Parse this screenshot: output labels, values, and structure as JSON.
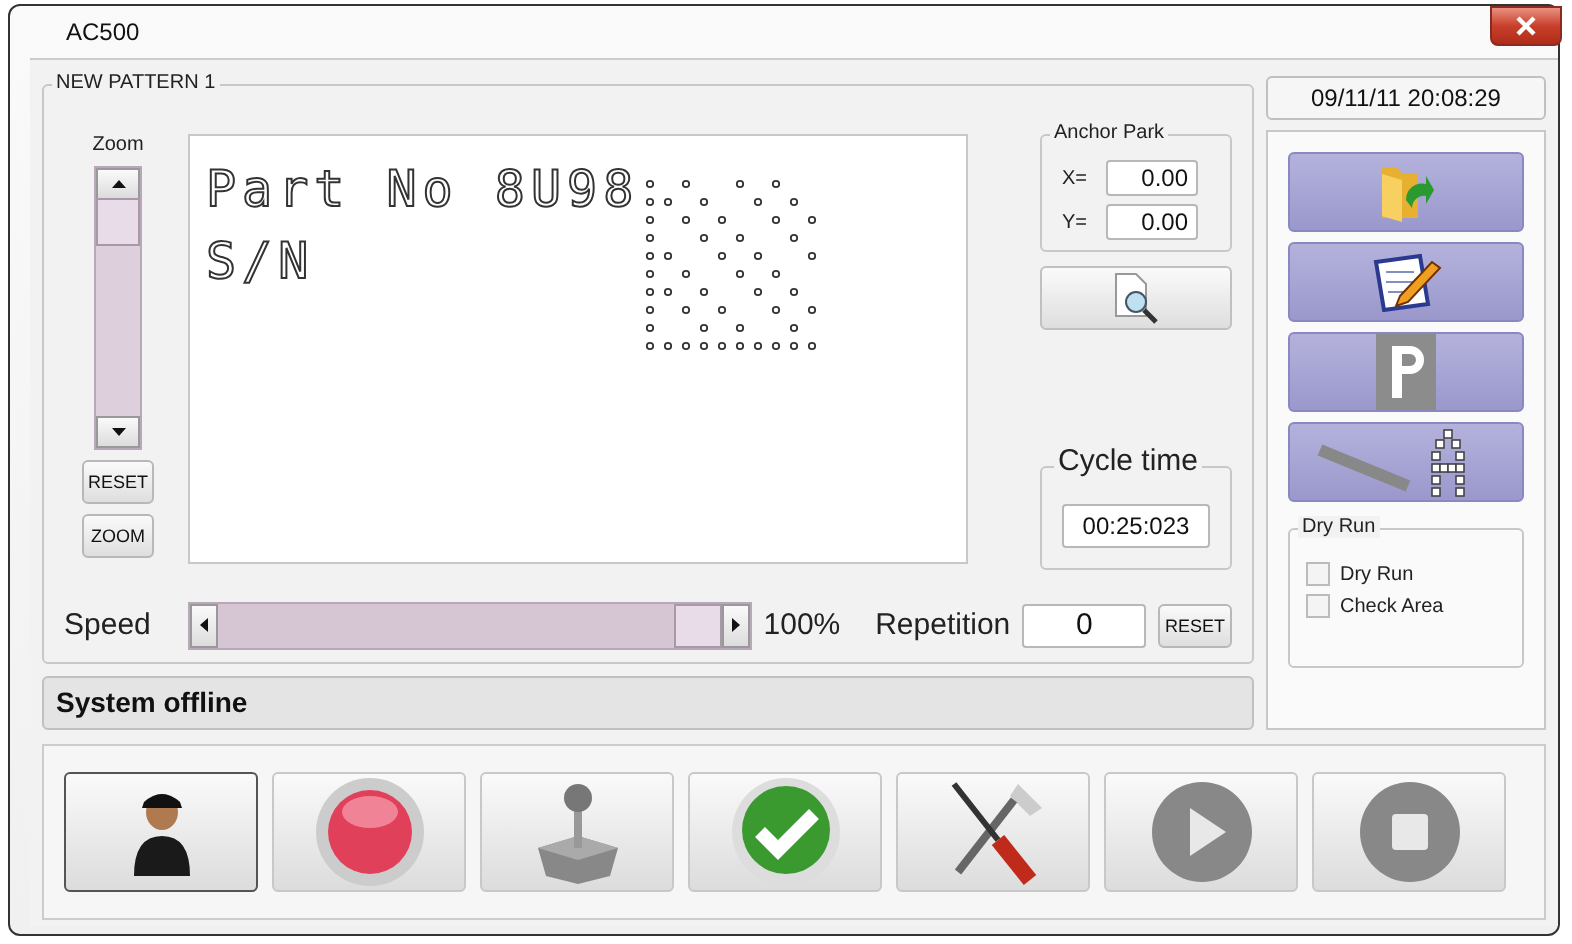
{
  "window": {
    "title": "AC500"
  },
  "pattern_panel": {
    "title": "NEW PATTERN 1",
    "zoom": {
      "label": "Zoom",
      "buttons": [
        "RESET",
        "ZOOM"
      ]
    },
    "canvas": {
      "lines": [
        "Part No 8U98",
        "S/N"
      ]
    },
    "anchor_park": {
      "title": "Anchor Park",
      "fields": [
        {
          "label": "X=",
          "value": "0.00"
        },
        {
          "label": "Y=",
          "value": "0.00"
        }
      ]
    },
    "cycle_time": {
      "title": "Cycle time",
      "value": "00:25:023"
    },
    "speed": {
      "label": "Speed",
      "level": 1,
      "reading": "100%"
    },
    "repetition": {
      "label": "Repetition",
      "value": "0",
      "button": "RESET"
    }
  },
  "status_bar": {
    "text": "System offline"
  },
  "clock": "09/11/11 20:08:29",
  "side_buttons": [
    {
      "kind": "open"
    },
    {
      "kind": "edit"
    },
    {
      "kind": "park"
    },
    {
      "kind": "mark"
    }
  ],
  "dry_run": {
    "title": "Dry Run",
    "options": [
      {
        "label": "Dry Run",
        "checked": false
      },
      {
        "label": "Check Area",
        "checked": false
      }
    ]
  },
  "toolbar": [
    {
      "kind": "user",
      "selected": true
    },
    {
      "kind": "record",
      "selected": false
    },
    {
      "kind": "joystick",
      "selected": false
    },
    {
      "kind": "check",
      "selected": false
    },
    {
      "kind": "tools",
      "selected": false
    },
    {
      "kind": "play",
      "selected": false
    },
    {
      "kind": "stop",
      "selected": false
    }
  ]
}
